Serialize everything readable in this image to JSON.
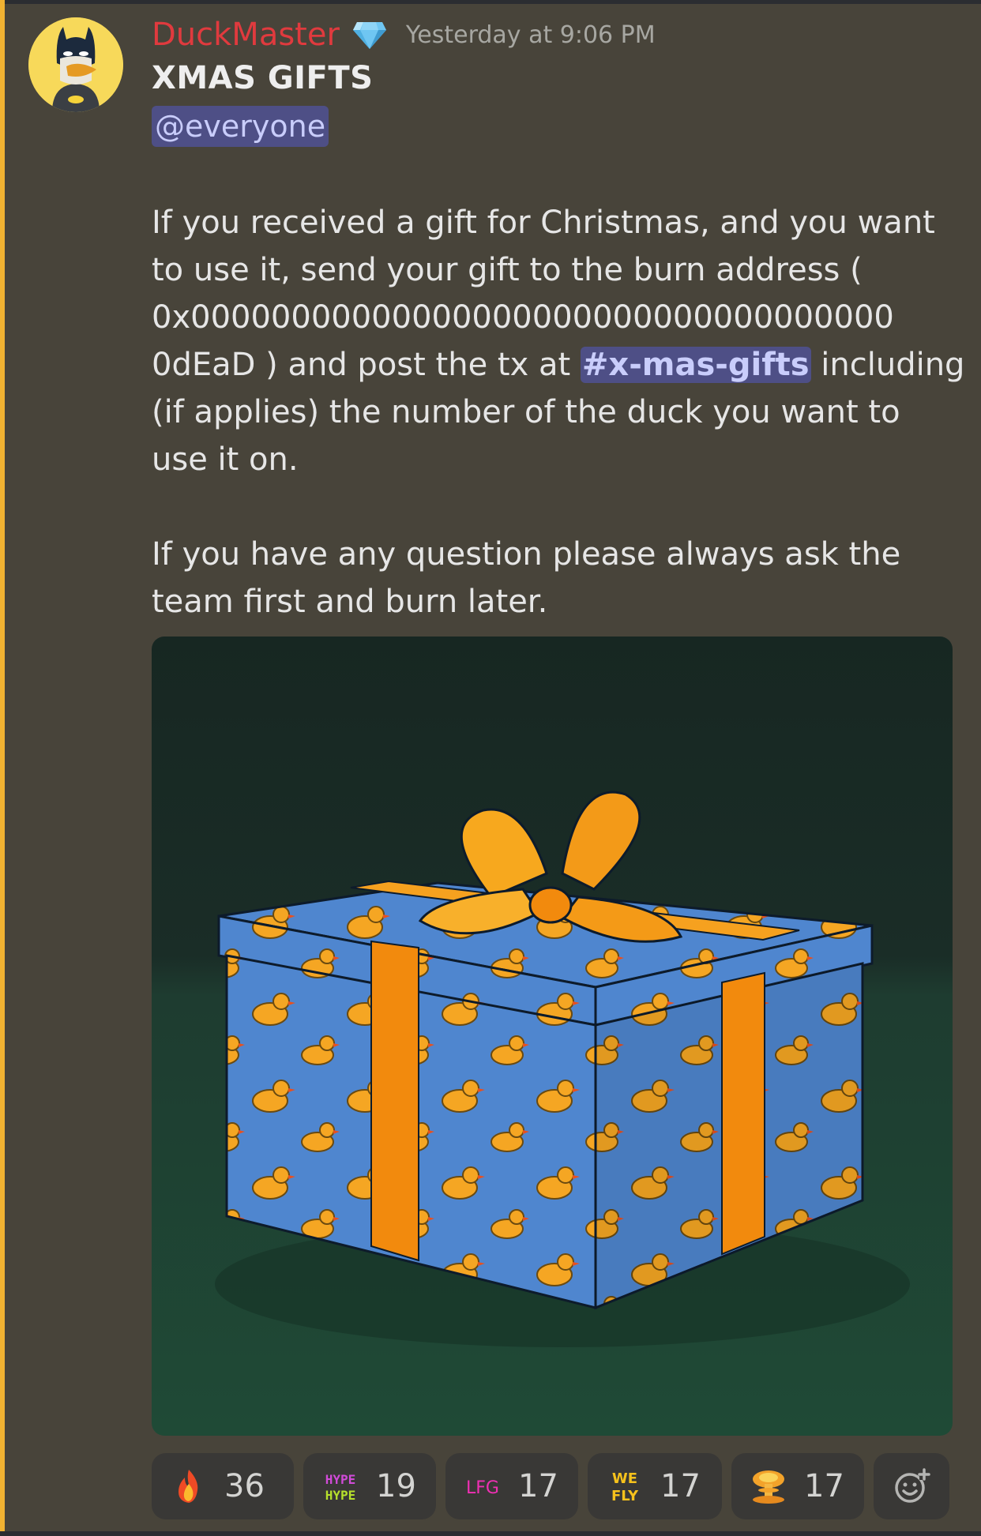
{
  "message": {
    "author": "DuckMaster",
    "badge_icon": "diamond-icon",
    "timestamp": "Yesterday at 9:06 PM",
    "title": "XMAS GIFTS",
    "mention": "@everyone",
    "para1_before": "If you received a gift for Christmas, and you want to use it,  send your gift to the burn address ( 0x00000000000000000000000000000000000 0dEaD ) and post the tx at ",
    "channel": "#x-mas-gifts",
    "para1_after": " including (if applies) the number of the duck you want to use it on.",
    "para2": "If you have any question please always ask the team first and burn later."
  },
  "image": {
    "description_icon": "gift-box-illustration"
  },
  "reactions": [
    {
      "icon": "fire-icon",
      "count": "36"
    },
    {
      "icon": "hype-emoji-icon",
      "count": "19"
    },
    {
      "icon": "lfg-emoji-icon",
      "count": "17"
    },
    {
      "icon": "we-fly-emoji-icon",
      "count": "17"
    },
    {
      "icon": "mushroom-cloud-icon",
      "count": "17"
    }
  ],
  "colors": {
    "author": "#e03a3e",
    "mention_bg": "#4e4f86",
    "mention_text": "#c9cdfb",
    "background": "#48443a",
    "accent_bar": "#f0b232"
  }
}
